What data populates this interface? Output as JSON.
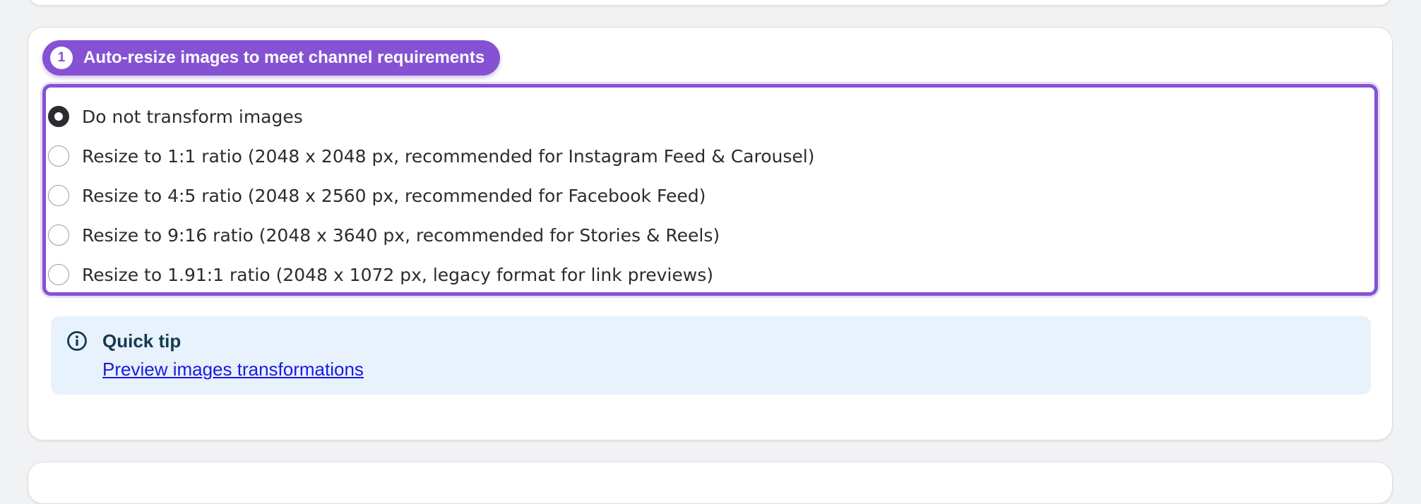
{
  "step": {
    "number": "1",
    "title": "Auto-resize images to meet channel requirements"
  },
  "options": [
    {
      "label": "Do not transform images",
      "checked": true
    },
    {
      "label": "Resize to 1:1 ratio (2048 x 2048 px, recommended for Instagram Feed & Carousel)",
      "checked": false
    },
    {
      "label": "Resize to 4:5 ratio (2048 x 2560 px, recommended for Facebook Feed)",
      "checked": false
    },
    {
      "label": "Resize to 9:16 ratio (2048 x 3640 px, recommended for Stories & Reels)",
      "checked": false
    },
    {
      "label": "Resize to 1.91:1 ratio (2048 x 1072 px, legacy format for link previews)",
      "checked": false
    }
  ],
  "tip": {
    "icon": "info-icon",
    "title": "Quick tip",
    "link_label": "Preview images transformations"
  },
  "colors": {
    "accent": "#8552d4",
    "tip_background": "#e7f2fd",
    "link": "#1a1ae0"
  }
}
